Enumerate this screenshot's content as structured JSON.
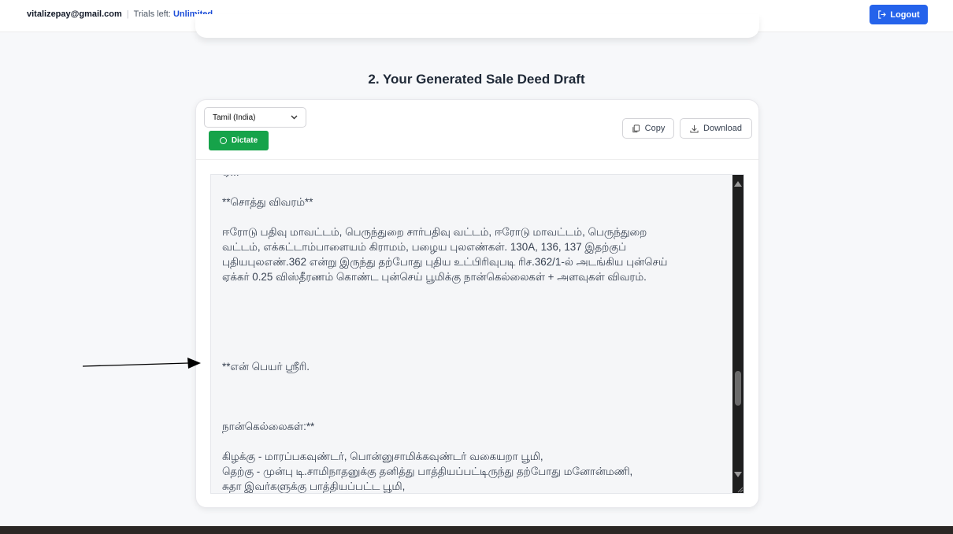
{
  "header": {
    "email": "vitalizepay@gmail.com",
    "separator": "|",
    "trials_label": "Trials left:",
    "trials_value": "Unlimited",
    "logout_label": "Logout"
  },
  "section": {
    "title": "2. Your Generated Sale Deed Draft"
  },
  "toolbar": {
    "language_selected": "Tamil (India)",
    "dictate_label": "Dictate",
    "copy_label": "Copy",
    "download_label": "Download"
  },
  "draft": {
    "heading_property": "**சொத்து விவரம்**",
    "property_lines": [
      "ஈரோடு பதிவு மாவட்டம், பெருந்துறை சார்பதிவு வட்டம், ஈரோடு மாவட்டம், பெருந்துறை",
      "வட்டம், எக்கட்டாம்பாளையம் கிராமம், பழைய புலஎண்கள். 130A, 136, 137 இதற்குப்",
      "புதியபுலஎண்.362 என்று இருந்து தற்போது புதிய உட்பிரிவுபடி ரிச.362/1-ல் அடங்கிய புன்செய்",
      "ஏக்கர் 0.25 விஸ்தீரணம் கொண்ட புன்செய் பூமிக்கு நான்கெல்லைகள் + அளவுகள் விவரம்."
    ],
    "name_line": "**என் பெயர் ஶ்ரீரி.",
    "boundaries_heading": "நான்கெல்லைகள்:**",
    "boundary_lines": [
      "கிழக்கு - மாரப்பகவுண்டர், பொன்னுசாமிக்கவுண்டர் வகையறா பூமி,",
      "தெற்கு - முன்பு டி.சாமிநாதனுக்கு தனித்து பாத்தியப்பட்டிருந்து தற்போது மனோன்மணி,",
      "சுதா இவர்களுக்கு பாத்தியப்பட்ட பூமி,"
    ]
  },
  "colors": {
    "logout_bg": "#2563eb",
    "dictate_bg": "#16a34a",
    "trials_value": "#1d4ed8",
    "scrollbar": "#1f1f1f"
  },
  "icons": {
    "logout": "logout-icon",
    "dictate": "record-ring-icon",
    "copy": "copy-icon",
    "download": "download-icon",
    "select": "chevron-down-icon"
  }
}
